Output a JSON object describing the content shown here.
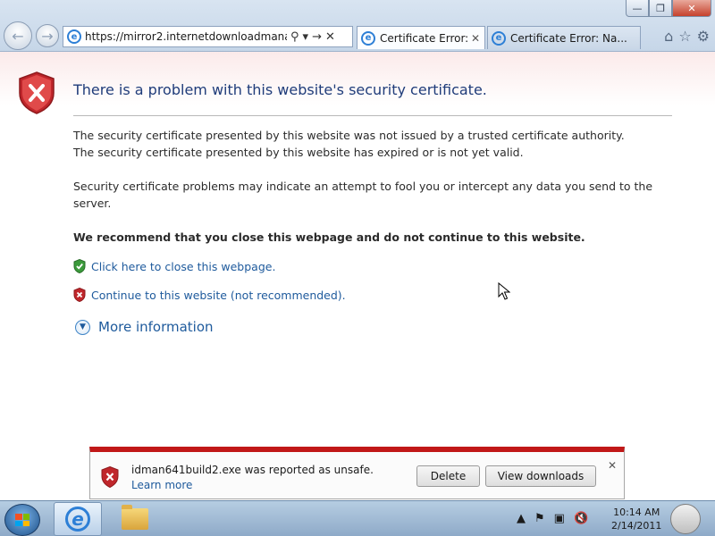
{
  "window": {
    "minimize_icon": "minimize-icon",
    "maximize_icon": "restore-icon",
    "close_icon": "close-icon"
  },
  "address_bar": {
    "url": "https://mirror2.internetdownloadmanager.c",
    "icons": [
      "search-icon",
      "dropdown-icon",
      "go-icon",
      "stop-icon"
    ]
  },
  "tabs": [
    {
      "label": "Certificate Error: ...",
      "active": true
    },
    {
      "label": "Certificate Error: Na...",
      "active": false
    }
  ],
  "toolbar_icons": [
    "home-icon",
    "favorites-star-icon",
    "tools-gear-icon"
  ],
  "page": {
    "title": "There is a problem with this website's security certificate.",
    "paragraph1_line1": "The security certificate presented by this website was not issued by a trusted certificate authority.",
    "paragraph1_line2": "The security certificate presented by this website has expired or is not yet valid.",
    "paragraph2": "Security certificate problems may indicate an attempt to fool you or intercept any data you send to the server.",
    "recommendation": "We recommend that you close this webpage and do not continue to this website.",
    "close_link": "Click here to close this webpage.",
    "continue_link": "Continue to this website (not recommended).",
    "more_info": "More information"
  },
  "notification": {
    "message": "idman641build2.exe was reported as unsafe.",
    "learn_more": "Learn more",
    "delete_label": "Delete",
    "view_downloads_label": "View downloads"
  },
  "taskbar": {
    "time": "10:14 AM",
    "date": "2/14/2011",
    "tray_icons": [
      "show-hidden-icons-arrow",
      "action-center-flag-icon",
      "network-icon",
      "volume-muted-icon"
    ]
  },
  "colors": {
    "title_blue": "#1f3c7a",
    "link_blue": "#1e5a9c",
    "warning_red": "#c11818",
    "safe_green": "#3b9a3b"
  }
}
